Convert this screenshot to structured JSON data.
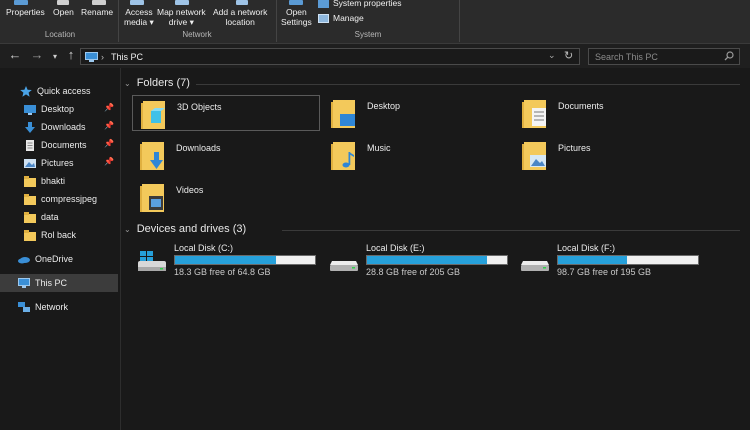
{
  "ribbon": {
    "properties_label": "Properties",
    "open_label": "Open",
    "rename_label": "Rename",
    "access_media_line1": "Access",
    "access_media_line2": "media ▾",
    "map_network_line1": "Map network",
    "map_network_line2": "drive ▾",
    "add_location_line1": "Add a network",
    "add_location_line2": "location",
    "open_settings_line1": "Open",
    "open_settings_line2": "Settings",
    "system_properties_label": "System properties",
    "manage_label": "Manage",
    "group_location": "Location",
    "group_network": "Network",
    "group_system": "System"
  },
  "navigation": {
    "path": "This PC",
    "separator": "›",
    "search_placeholder": "Search This PC"
  },
  "sidebar": {
    "items": [
      {
        "label": "Quick access",
        "icon": "star-icon"
      },
      {
        "label": "Desktop",
        "icon": "desktop-folder-icon",
        "pinned": true
      },
      {
        "label": "Downloads",
        "icon": "downloads-icon",
        "pinned": true
      },
      {
        "label": "Documents",
        "icon": "documents-icon",
        "pinned": true
      },
      {
        "label": "Pictures",
        "icon": "pictures-icon",
        "pinned": true
      },
      {
        "label": "bhakti",
        "icon": "folder-icon"
      },
      {
        "label": "compressjpeg",
        "icon": "folder-icon"
      },
      {
        "label": "data",
        "icon": "folder-icon"
      },
      {
        "label": "Rol back",
        "icon": "folder-icon"
      },
      {
        "label": "OneDrive",
        "icon": "cloud-icon"
      },
      {
        "label": "This PC",
        "icon": "computer-icon",
        "selected": true
      },
      {
        "label": "Network",
        "icon": "network-icon"
      }
    ]
  },
  "content": {
    "folders_heading": "Folders (7)",
    "folders": [
      {
        "label": "3D Objects",
        "icon": "3d-objects-folder-icon"
      },
      {
        "label": "Desktop",
        "icon": "desktop-folder-icon"
      },
      {
        "label": "Documents",
        "icon": "documents-folder-icon"
      },
      {
        "label": "Downloads",
        "icon": "downloads-folder-icon"
      },
      {
        "label": "Music",
        "icon": "music-folder-icon"
      },
      {
        "label": "Pictures",
        "icon": "pictures-folder-icon"
      },
      {
        "label": "Videos",
        "icon": "videos-folder-icon"
      }
    ],
    "drives_heading": "Devices and drives (3)",
    "drives": [
      {
        "label": "Local Disk (C:)",
        "free_text": "18.3 GB free of 64.8 GB",
        "used_fraction": 0.72
      },
      {
        "label": "Local Disk (E:)",
        "free_text": "28.8 GB free of 205 GB",
        "used_fraction": 0.86
      },
      {
        "label": "Local Disk (F:)",
        "free_text": "98.7 GB free of 195 GB",
        "used_fraction": 0.49
      }
    ]
  },
  "colors": {
    "accent": "#26a0da",
    "folder_yellow": "#f3c95b",
    "background": "#191919"
  }
}
